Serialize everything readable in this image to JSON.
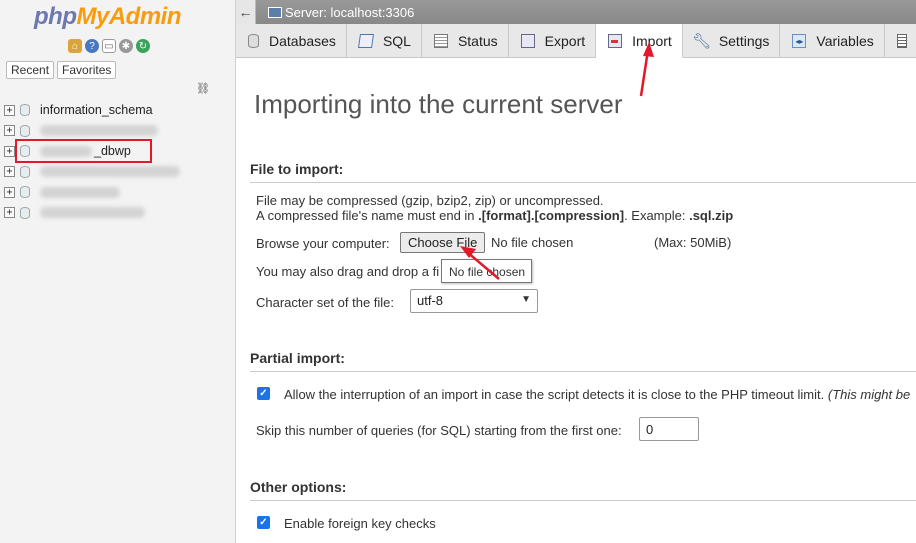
{
  "nav": {
    "logo_php": "php",
    "logo_myadmin": "MyAdmin",
    "icons": [
      "home-icon",
      "help-icon",
      "docs-icon",
      "settings-icon",
      "reload-icon"
    ],
    "tabs": [
      "Recent",
      "Favorites"
    ],
    "databases": [
      {
        "name": "information_schema",
        "blurred": false
      },
      {
        "name": "",
        "blurred": true
      },
      {
        "name": "_dbwp",
        "blurred": "partial"
      },
      {
        "name": "",
        "blurred": true
      },
      {
        "name": "",
        "blurred": true
      },
      {
        "name": "",
        "blurred": true
      }
    ]
  },
  "topbar": {
    "back": "←",
    "server": "Server: localhost:3306"
  },
  "tabs": [
    {
      "label": "Databases",
      "icon": "database-icon"
    },
    {
      "label": "SQL",
      "icon": "sql-icon"
    },
    {
      "label": "Status",
      "icon": "status-icon"
    },
    {
      "label": "Export",
      "icon": "export-icon"
    },
    {
      "label": "Import",
      "icon": "import-icon",
      "active": true
    },
    {
      "label": "Settings",
      "icon": "settings-wrench-icon"
    },
    {
      "label": "Variables",
      "icon": "variables-icon"
    }
  ],
  "main": {
    "title": "Importing into the current server",
    "file_section": {
      "heading": "File to import:",
      "line1": "File may be compressed (gzip, bzip2, zip) or uncompressed.",
      "line2_prefix": "A compressed file's name must end in ",
      "line2_bold": ".[format].[compression]",
      "line2_mid": ". Example: ",
      "line2_example": ".sql.zip",
      "browse_label": "Browse your computer:",
      "choose_button": "Choose File",
      "no_file": "No file chosen",
      "max_size": "(Max: 50MiB)",
      "drag_label": "You may also drag and drop a fi",
      "tooltip": "No file chosen",
      "charset_label": "Character set of the file:",
      "charset_value": "utf-8"
    },
    "partial_section": {
      "heading": "Partial import:",
      "allow_interrupt": "Allow the interruption of an import in case the script detects it is close to the PHP timeout limit.",
      "allow_interrupt_note": "(This might be",
      "skip_label": "Skip this number of queries (for SQL) starting from the first one:",
      "skip_value": "0"
    },
    "other_section": {
      "heading": "Other options:",
      "foreign_keys": "Enable foreign key checks"
    }
  },
  "colors": {
    "annotation_red": "#e3192a",
    "checkbox_blue": "#1a73e8",
    "logo_blue": "#6c78af",
    "logo_orange": "#f89c0e"
  }
}
